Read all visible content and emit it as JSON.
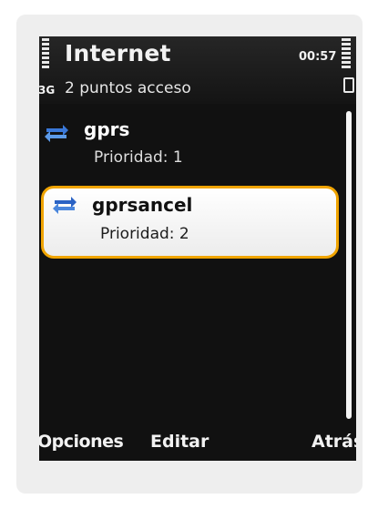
{
  "header": {
    "title": "Internet",
    "time": "00:57",
    "network": "3G",
    "subtitle": "2 puntos acceso"
  },
  "list": {
    "items": [
      {
        "name": "gprs",
        "priority": "Prioridad: 1",
        "selected": false,
        "icon": "access-point-arrows-icon"
      },
      {
        "name": "gprsancel",
        "priority": "Prioridad: 2",
        "selected": true,
        "icon": "access-point-arrows-icon"
      }
    ]
  },
  "softkeys": {
    "left": "Opciones",
    "middle": "Editar",
    "right": "Atrás"
  },
  "colors": {
    "highlight_border": "#f0a400",
    "arrow_blue": "#3a78d8",
    "screen_bg": "#111111"
  }
}
